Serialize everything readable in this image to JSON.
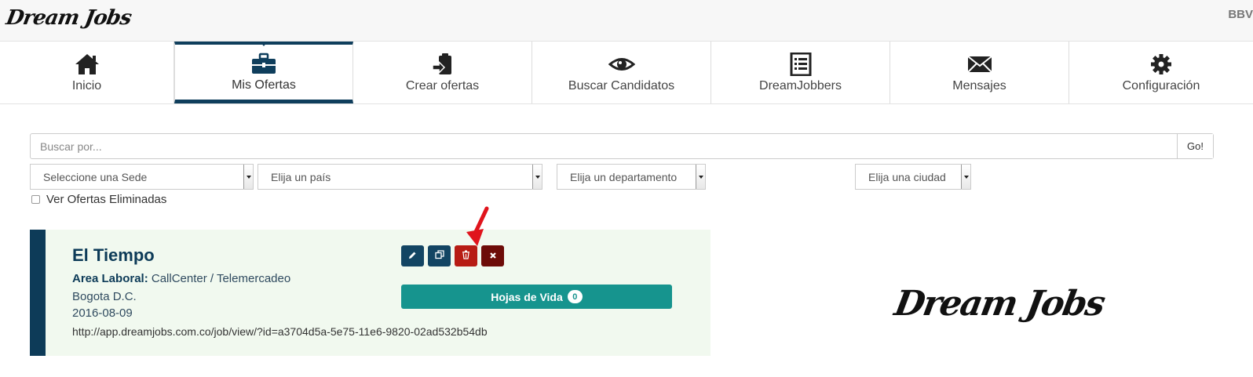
{
  "header": {
    "logo_text": "Dream Jobs",
    "user_tag": "BBV"
  },
  "nav": {
    "items": [
      {
        "label": "Inicio",
        "icon": "home-icon"
      },
      {
        "label": "Mis Ofertas",
        "icon": "briefcase-icon",
        "active": true
      },
      {
        "label": "Crear ofertas",
        "icon": "clipboard-icon"
      },
      {
        "label": "Buscar Candidatos",
        "icon": "eye-icon"
      },
      {
        "label": "DreamJobbers",
        "icon": "list-icon"
      },
      {
        "label": "Mensajes",
        "icon": "envelope-icon"
      },
      {
        "label": "Configuración",
        "icon": "gear-icon"
      }
    ]
  },
  "search": {
    "placeholder": "Buscar por...",
    "value": "",
    "go_label": "Go!"
  },
  "filters": {
    "sede": "Seleccione una Sede",
    "pais": "Elija un país",
    "departamento": "Elija un departamento",
    "ciudad": "Elija una ciudad",
    "deleted_checkbox_label": "Ver Ofertas Eliminadas"
  },
  "offer": {
    "company": "El Tiempo",
    "area_label": "Area Laboral:",
    "area_value": "CallCenter / Telemercadeo",
    "location": "Bogota D.C.",
    "date": "2016-08-09",
    "url": "http://app.dreamjobs.com.co/job/view/?id=a3704d5a-5e75-11e6-9820-02ad532b54db",
    "cv_button_label": "Hojas de Vida",
    "cv_count": "0"
  },
  "brand": {
    "logo_text": "Dream Jobs"
  },
  "colors": {
    "nav_active": "#0f3e5c",
    "card_bg": "#f1f9ef",
    "cv_button": "#16948e",
    "delete_button": "#b71c14"
  }
}
